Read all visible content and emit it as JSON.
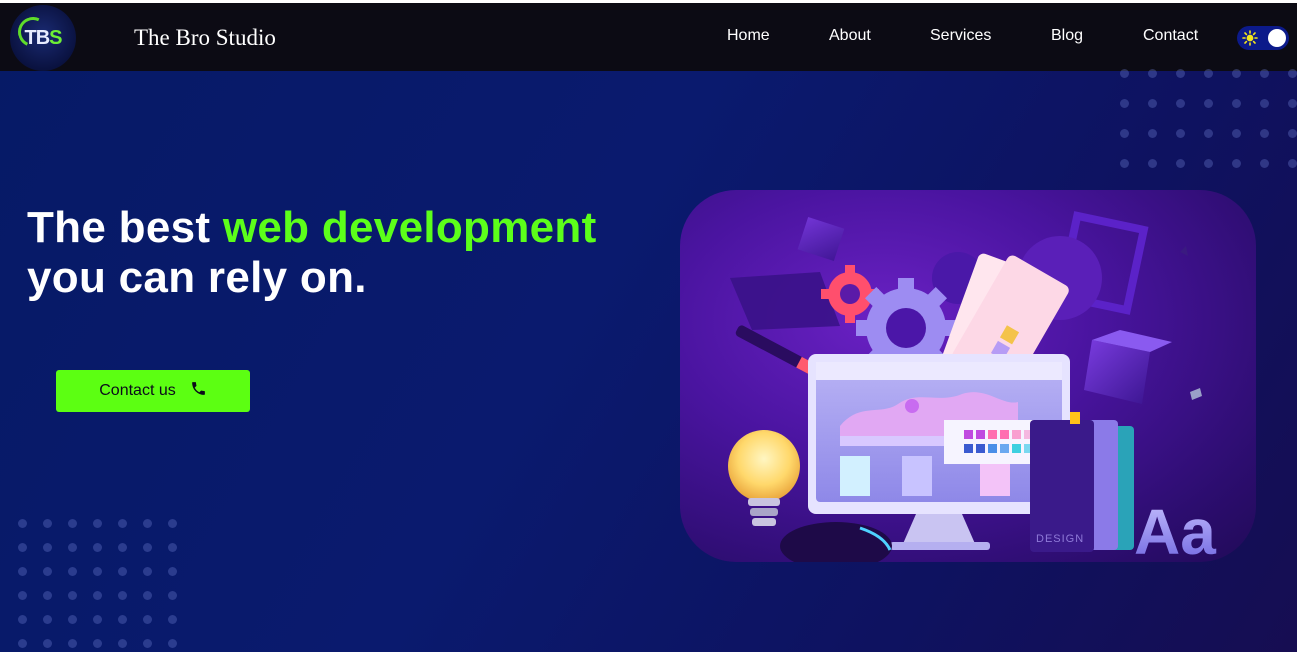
{
  "brand": {
    "logo_text_main": "TB",
    "logo_text_accent": "S",
    "name": "The Bro Studio"
  },
  "nav": {
    "items": [
      {
        "label": "Home"
      },
      {
        "label": "About"
      },
      {
        "label": "Services"
      },
      {
        "label": "Blog"
      },
      {
        "label": "Contact"
      }
    ]
  },
  "theme_toggle": {
    "icon": "sun-icon",
    "state": "on"
  },
  "hero": {
    "title_prefix": "The best ",
    "title_highlight": "web development",
    "title_suffix": "you can rely on.",
    "cta_label": "Contact us",
    "cta_icon": "phone-icon",
    "illustration_text_design": "DESIGN",
    "illustration_text_aa": "Aa"
  },
  "colors": {
    "accent_green": "#5cff12",
    "navbar_bg": "#0c0b14",
    "hero_bg": "#0a1a6e",
    "illustration_bg": "#4a14a0"
  }
}
